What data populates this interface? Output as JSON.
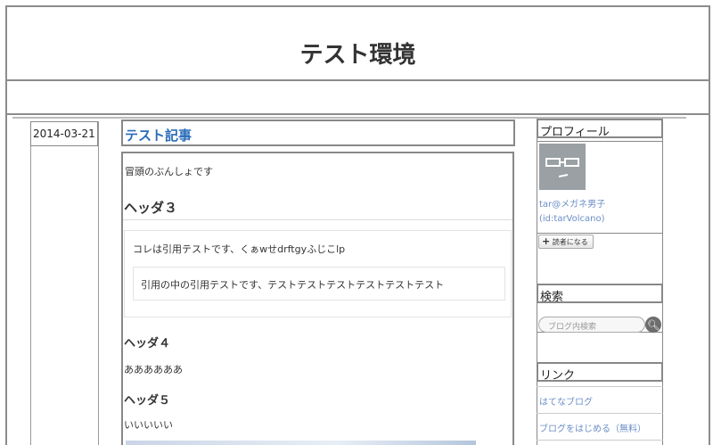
{
  "blog": {
    "title": "テスト環境"
  },
  "entry": {
    "date": "2014-03-21",
    "title": "テスト記事",
    "intro": "冒頭のぶんしょです",
    "heading3": "ヘッダ３",
    "quote": "コレは引用テストです、くぁwせdrftgyふじこlp",
    "nested_quote": "引用の中の引用テストです、テストテストテストテストテストテスト",
    "heading4": "ヘッダ４",
    "text4": "ああああああ",
    "heading5": "ヘッダ５",
    "text5": "いいいいい"
  },
  "sidebar": {
    "profile": {
      "heading": "プロフィール",
      "name": "tar@メガネ男子",
      "id": "(id:tarVolcano)",
      "reader_button": "読者になる",
      "reader_icon": "plus-icon"
    },
    "search": {
      "heading": "検索",
      "placeholder": "ブログ内検索",
      "button_icon": "search-icon"
    },
    "links": {
      "heading": "リンク",
      "items": [
        "はてなブログ",
        "ブログをはじめる（無料）"
      ]
    }
  },
  "colors": {
    "link": "#2a6cb8",
    "sidebar_link": "#6b8ec6",
    "border": "#888888"
  }
}
